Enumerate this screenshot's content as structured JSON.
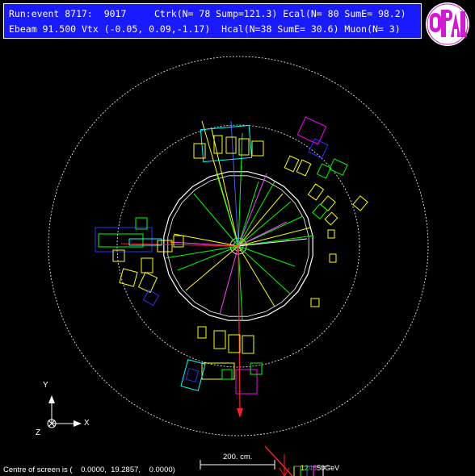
{
  "header": {
    "line1": "Run:event 8717:  9017     Ctrk(N= 78 Sump=121.3) Ecal(N= 80 SumE= 98.2)",
    "line2": "Ebeam 91.500 Vtx (-0.05, 0.09,-1.17)  Hcal(N=38 SumE= 30.6) Muon(N= 3)"
  },
  "logo": {
    "text": "OPAL",
    "colors": {
      "bg": "#ffffff",
      "fill": "#d21ad2"
    }
  },
  "axes": {
    "y": "Y",
    "x": "X",
    "z": "Z"
  },
  "scale_bar": {
    "label": "200. cm."
  },
  "energy_scale": {
    "values": [
      "1",
      "2",
      "4",
      "8",
      "50"
    ],
    "unit": "GeV",
    "colors": [
      "#ffff00",
      "#00ff00",
      "#4060ff",
      "#ff40ff",
      "#ffffff"
    ]
  },
  "footer": {
    "centre_text": "Centre of screen is (    0.0000,  19.2857,    0.0000)"
  },
  "colors": {
    "header_bg": "#1a1aff",
    "ecal": "#ffff00",
    "hcal": "#00ff00",
    "muon": "#ff00ff",
    "track_blue": "#3030ff",
    "cyan": "#00ffff",
    "red": "#ff2020"
  }
}
